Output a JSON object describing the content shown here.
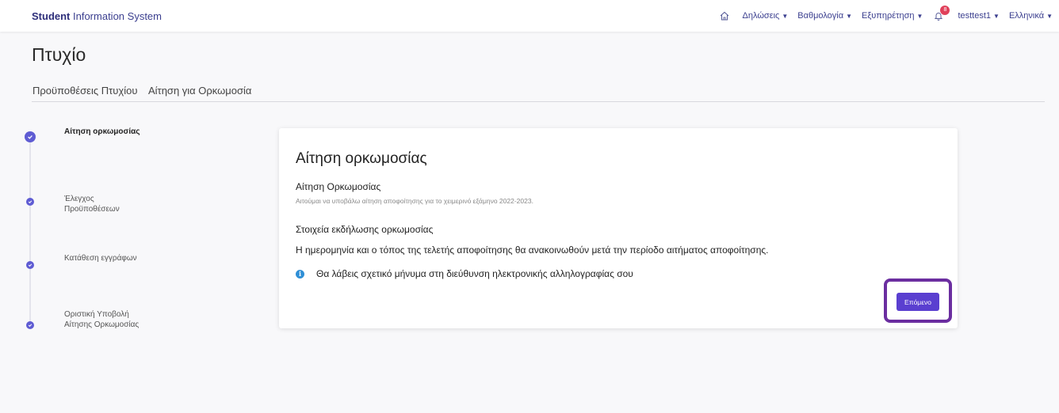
{
  "header": {
    "brand_bold": "Student",
    "brand_rest": " Information System",
    "nav": [
      {
        "label": "Δηλώσεις"
      },
      {
        "label": "Βαθμολογία"
      },
      {
        "label": "Εξυπηρέτηση"
      }
    ],
    "notification_count": "8",
    "user": "testtest1",
    "language": "Ελληνικά",
    "icons": {
      "home": "home-icon",
      "bell": "bell-icon",
      "chevron": "chevron-down-icon"
    }
  },
  "page": {
    "title": "Πτυχίο",
    "tabs": [
      {
        "label": "Προϋποθέσεις Πτυχίου"
      },
      {
        "label": "Αίτηση για Ορκωμοσία"
      }
    ]
  },
  "steps": [
    {
      "label": "Αίτηση ορκωμοσίας",
      "active": true
    },
    {
      "label": "Έλεγχος Προϋποθέσεων",
      "active": false
    },
    {
      "label": "Κατάθεση εγγράφων",
      "active": false
    },
    {
      "label": "Οριστική Υποβολή Αίτησης Ορκωμοσίας",
      "active": false
    }
  ],
  "card": {
    "title": "Αίτηση ορκωμοσίας",
    "section1_title": "Αίτηση Ορκωμοσίας",
    "section1_sub": "Αιτούμαι να υποβάλω αίτηση αποφοίτησης για το χειμερινό εξάμηνο 2022-2023.",
    "section2_title": "Στοιχεία εκδήλωσης ορκωμοσίας",
    "body": "Η ημερομηνία και ο τόπος της τελετής αποφοίτησης θα ανακοινωθούν μετά την περίοδο αιτήματος αποφοίτησης.",
    "info": "Θα λάβεις σχετικό μήνυμα στη διεύθυνση ηλεκτρονικής αλληλογραφίας σου",
    "info_icon": "info-icon",
    "next_label": "Επόμενο"
  },
  "colors": {
    "accent": "#5a3fd0",
    "step": "#5f5cd3",
    "highlight": "#6b2ea0",
    "badge": "#e0405a",
    "info": "#2f8fd6"
  }
}
